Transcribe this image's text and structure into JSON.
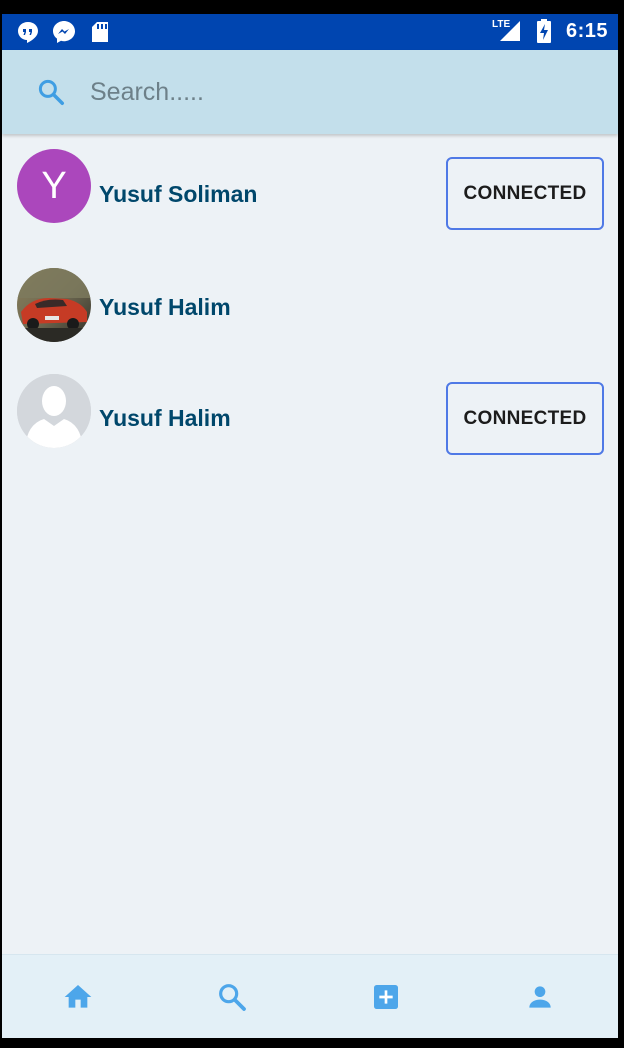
{
  "status_bar": {
    "network_label": "LTE",
    "time": "6:15",
    "icons": [
      "hangouts-icon",
      "messenger-icon",
      "sd-card-icon",
      "lte-signal-icon",
      "battery-charging-icon"
    ]
  },
  "search": {
    "placeholder": "Search.....",
    "value": "",
    "icon": "search-icon"
  },
  "results": [
    {
      "name": "Yusuf Soliman",
      "avatar_type": "letter",
      "avatar_letter": "Y",
      "avatar_color": "#ab47bc",
      "button_label": "CONNECTED"
    },
    {
      "name": "Yusuf Halim",
      "avatar_type": "photo",
      "avatar_desc": "red-car-photo"
    },
    {
      "name": "Yusuf Halim",
      "avatar_type": "default",
      "button_label": "CONNECTED"
    }
  ],
  "bottom_nav": {
    "items": [
      {
        "icon": "home-icon"
      },
      {
        "icon": "search-icon"
      },
      {
        "icon": "add-box-icon"
      },
      {
        "icon": "person-icon"
      }
    ]
  },
  "colors": {
    "status_bar": "#0045b0",
    "search_bar": "#c3dfeb",
    "background": "#edf2f6",
    "name_text": "#00476b",
    "button_border": "#4f79e6",
    "nav_icon": "#4da6ea"
  }
}
